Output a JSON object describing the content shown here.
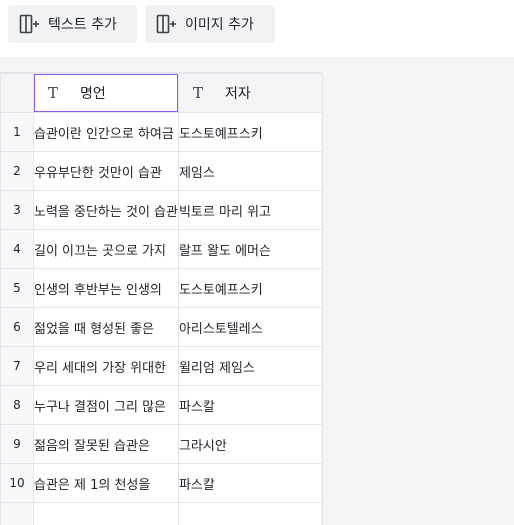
{
  "toolbar": {
    "add_text_label": "텍스트 추가",
    "add_image_label": "이미지 추가"
  },
  "columns": [
    {
      "type_icon": "T",
      "label": "명언"
    },
    {
      "type_icon": "T",
      "label": "저자"
    }
  ],
  "rows": [
    {
      "num": "1",
      "quote": "습관이란 인간으로 하여금",
      "author": "도스토예프스키"
    },
    {
      "num": "2",
      "quote": "우유부단한 것만이 습관",
      "author": "제임스"
    },
    {
      "num": "3",
      "quote": "노력을 중단하는 것이 습관",
      "author": "빅토르 마리 위고"
    },
    {
      "num": "4",
      "quote": "길이 이끄는 곳으로 가지",
      "author": "랄프 왈도 에머슨"
    },
    {
      "num": "5",
      "quote": "인생의 후반부는 인생의",
      "author": "도스토예프스키"
    },
    {
      "num": "6",
      "quote": "젊었을 때 형성된 좋은",
      "author": "아리스토텔레스"
    },
    {
      "num": "7",
      "quote": "우리 세대의 가장 위대한",
      "author": "윌리엄 제임스"
    },
    {
      "num": "8",
      "quote": "누구나 결점이 그리 많은",
      "author": "파스칼"
    },
    {
      "num": "9",
      "quote": "젊음의 잘못된 습관은",
      "author": "그라시안"
    },
    {
      "num": "10",
      "quote": "습관은 제 1의 천성을",
      "author": "파스칼"
    },
    {
      "num": "",
      "quote": "",
      "author": ""
    }
  ]
}
